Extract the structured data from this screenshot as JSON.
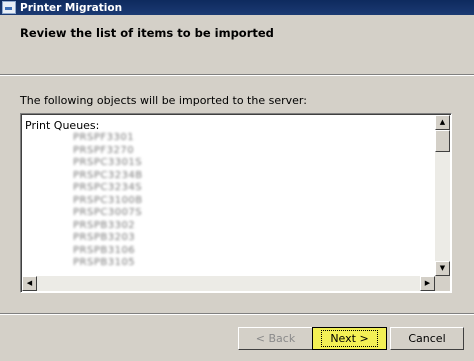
{
  "window": {
    "title": "Printer Migration"
  },
  "header": {
    "title": "Review the list of items to be imported"
  },
  "main": {
    "intro": "The following objects will be imported to the server:",
    "list": {
      "group_label": "Print Queues:",
      "items": [
        "PRSPF3301",
        "PRSPF3270",
        "PRSPC3301S",
        "PRSPC3234B",
        "PRSPC3234S",
        "PRSPC3100B",
        "PRSPC3007S",
        "PRSPB3302",
        "PRSPB3203",
        "PRSPB3106",
        "PRSPB3105"
      ]
    }
  },
  "buttons": {
    "back": "< Back",
    "next": "Next >",
    "cancel": "Cancel"
  }
}
